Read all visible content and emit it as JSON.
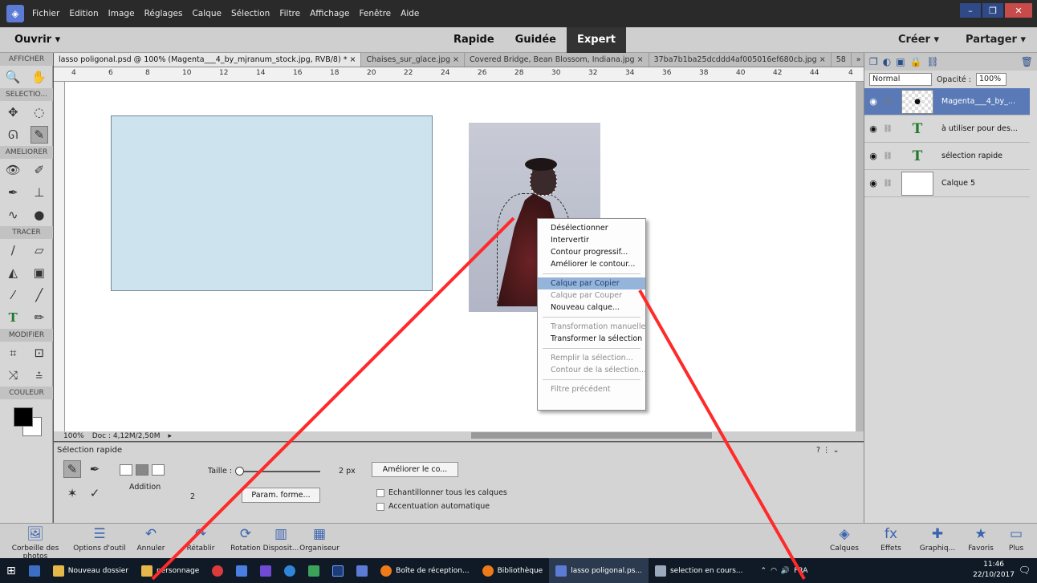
{
  "menubar": {
    "items": [
      "Fichier",
      "Edition",
      "Image",
      "Réglages",
      "Calque",
      "Sélection",
      "Filtre",
      "Affichage",
      "Fenêtre",
      "Aide"
    ]
  },
  "modebar": {
    "open": "Ouvrir",
    "modes": [
      "Rapide",
      "Guidée",
      "Expert"
    ],
    "active_mode": "Expert",
    "create": "Créer",
    "share": "Partager"
  },
  "toolbox": {
    "sections": [
      "AFFICHER",
      "SELECTIO...",
      "AMELIORER",
      "TRACER",
      "MODIFIER",
      "COULEUR"
    ]
  },
  "doc_tabs": [
    "lasso poligonal.psd @ 100% (Magenta___4_by_mjranum_stock.jpg, RVB/8) *",
    "Chaises_sur_glace.jpg",
    "Covered Bridge, Bean Blossom, Indiana.jpg",
    "37ba7b1ba25dcddd4af005016ef680cb.jpg",
    "58"
  ],
  "ruler": {
    "ticks": [
      "4",
      "6",
      "8",
      "10",
      "12",
      "14",
      "16",
      "18",
      "20",
      "22",
      "24",
      "26",
      "28",
      "30",
      "32",
      "34",
      "36",
      "38",
      "40",
      "42",
      "44",
      "4"
    ]
  },
  "context_menu": {
    "items": [
      {
        "label": "Désélectionner",
        "state": "enabled"
      },
      {
        "label": "Intervertir",
        "state": "enabled"
      },
      {
        "label": "Contour progressif...",
        "state": "enabled"
      },
      {
        "label": "Améliorer le contour...",
        "state": "enabled"
      },
      {
        "sep": true
      },
      {
        "label": "Calque par Copier",
        "state": "highlighted"
      },
      {
        "label": "Calque par Couper",
        "state": "disabled"
      },
      {
        "label": "Nouveau calque...",
        "state": "enabled"
      },
      {
        "sep": true
      },
      {
        "label": "Transformation manuelle",
        "state": "disabled"
      },
      {
        "label": "Transformer la sélection",
        "state": "enabled"
      },
      {
        "sep": true
      },
      {
        "label": "Remplir la sélection...",
        "state": "disabled"
      },
      {
        "label": "Contour de la sélection...",
        "state": "disabled"
      },
      {
        "sep": true
      },
      {
        "label": "Filtre précédent",
        "state": "disabled"
      }
    ]
  },
  "status": {
    "zoom": "100%",
    "doc": "Doc : 4,12M/2,50M"
  },
  "options": {
    "title": "Sélection rapide",
    "mode_label": "Addition",
    "size_label": "Taille :",
    "size_value": "2 px",
    "brush_number": "2",
    "brush_settings": "Param. forme...",
    "refine": "Améliorer le co...",
    "sample_all": "Echantillonner tous les calques",
    "auto_enhance": "Accentuation automatique"
  },
  "layers_panel": {
    "blend_mode": "Normal",
    "opacity_label": "Opacité :",
    "opacity_value": "100%",
    "layers": [
      {
        "name": "Magenta___4_by_...",
        "type": "image",
        "selected": true
      },
      {
        "name": "à utiliser pour des...",
        "type": "text",
        "selected": false
      },
      {
        "name": "sélection rapide",
        "type": "text",
        "selected": false
      },
      {
        "name": "Calque 5",
        "type": "fill",
        "selected": false
      }
    ],
    "text_thumb_glyph": "T"
  },
  "bottom_bar": {
    "left": [
      "Corbeille des photos",
      "Options d'outil",
      "Annuler",
      "Rétablir",
      "Rotation",
      "Disposit...",
      "Organiseur"
    ],
    "right": [
      "Calques",
      "Effets",
      "Graphiq...",
      "Favoris",
      "Plus"
    ]
  },
  "taskbar": {
    "items": [
      "Nouveau dossier",
      "personnage",
      "Boîte de réception...",
      "Bibliothèque",
      "lasso poligonal.ps...",
      "selection en cours..."
    ],
    "lang": "FRA",
    "time": "11:46",
    "date": "22/10/2017"
  },
  "colors": {
    "accent": "#5a79b7",
    "annotation": "#ff2a2a",
    "canvas_rect": "#cde3ee"
  }
}
